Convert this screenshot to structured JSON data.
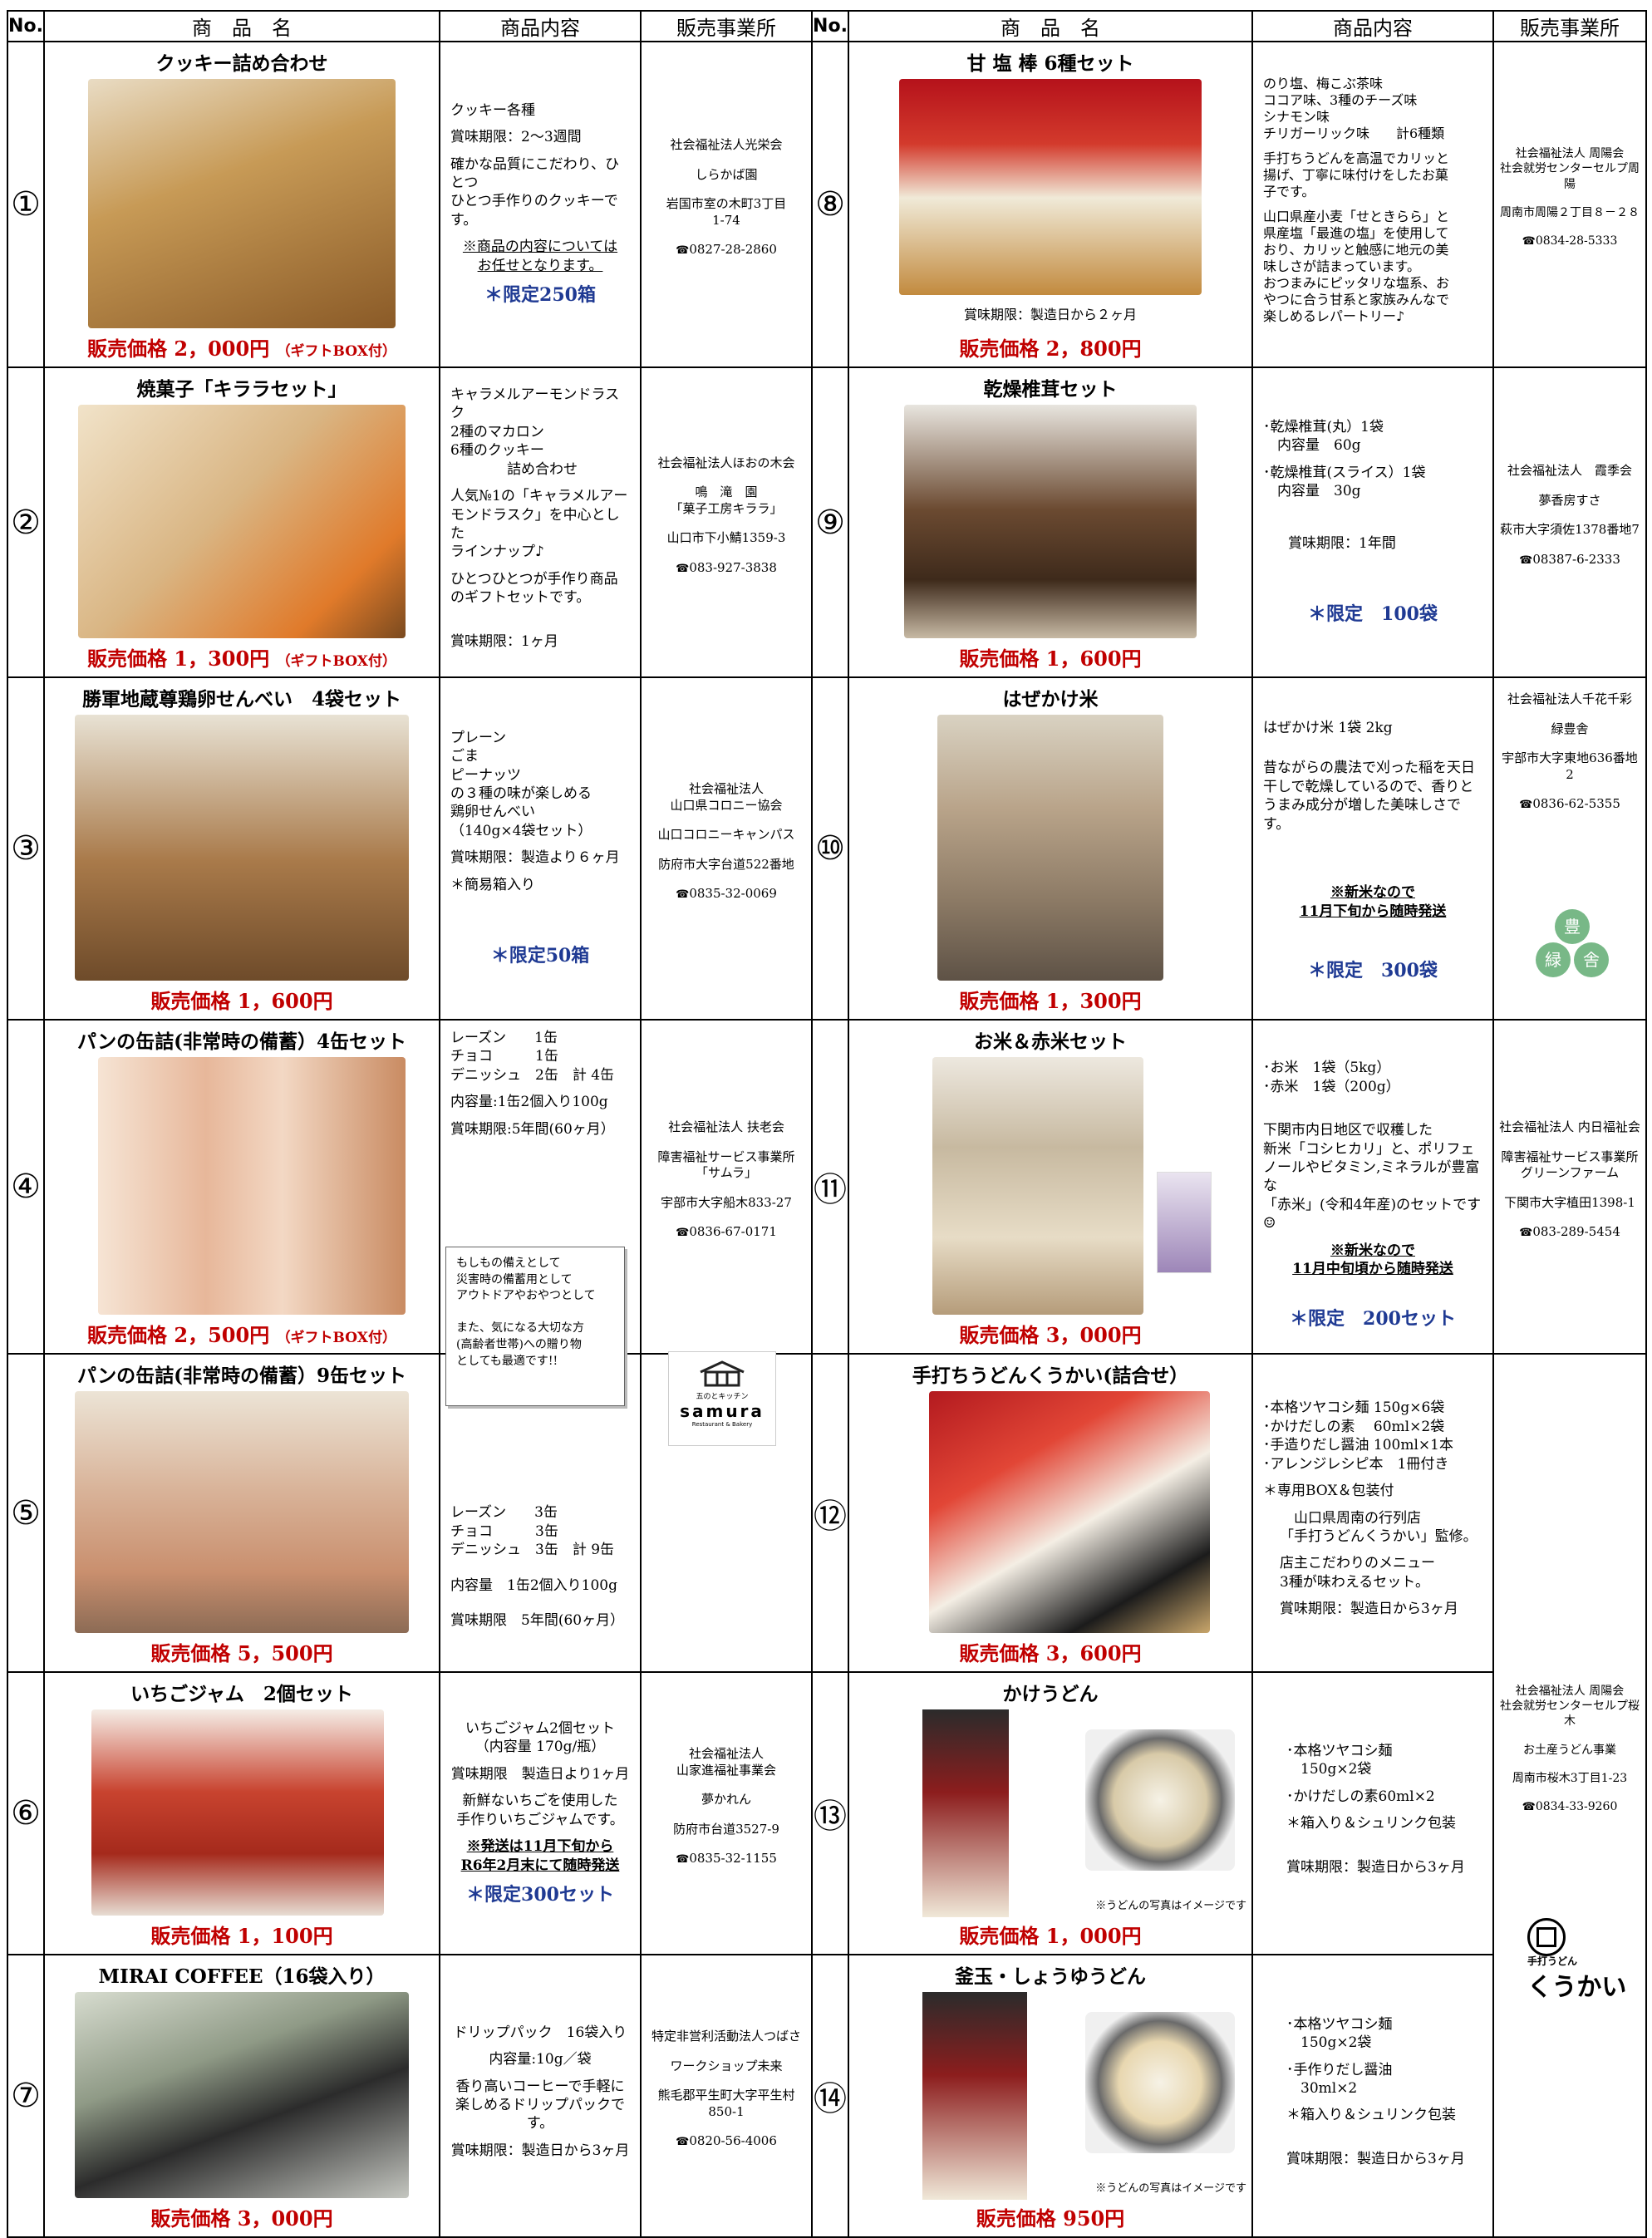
{
  "headers": {
    "no": "No.",
    "name": "商　品　名",
    "content": "商品内容",
    "seller": "販売事業所"
  },
  "products": [
    {
      "num": "①",
      "name": "クッキー詰め合わせ",
      "price": "販売価格 2，000円",
      "box": "（ギフトBOX付）",
      "content": [
        "クッキー各種",
        "賞味期限：2～3週間",
        "確かな品質にこだわり、ひとつ\nひとつ手作りのクッキーです。"
      ],
      "note_ul": "※商品の内容については\nお任せとなります。",
      "limit": "＊限定250箱",
      "seller": [
        "社会福祉法人光栄会",
        "しらかば園",
        "岩国市室の木町3丁目\n1-74"
      ],
      "tel": "0827-28-2860"
    },
    {
      "num": "②",
      "name": "焼菓子「キララセット」",
      "price": "販売価格 1，300円",
      "box": "（ギフトBOX付）",
      "content": [
        "キャラメルアーモンドラスク\n2種のマカロン\n6種のクッキー\n　　　　詰め合わせ",
        "人気№1の「キャラメルアー\nモンドラスク」を中心とした\nラインナップ♪",
        "ひとつひとつが手作り商品\nのギフトセットです。",
        "賞味期限：1ヶ月"
      ],
      "seller": [
        "社会福祉法人ほおの木会",
        "鳴　滝　園\n「菓子工房キララ」",
        "山口市下小鯖1359-3"
      ],
      "tel": "083-927-3838"
    },
    {
      "num": "③",
      "name": "勝軍地蔵尊鶏卵せんべい　4袋セット",
      "price": "販売価格 1，600円",
      "content": [
        "プレーン\nごま\nピーナッツ\nの３種の味が楽しめる\n鶏卵せんべい\n（140g×4袋セット）",
        "賞味期限：製造より６ヶ月",
        "＊簡易箱入り"
      ],
      "limit": "＊限定50箱",
      "seller": [
        "社会福祉法人\n山口県コロニー協会",
        "山口コロニーキャンパス",
        "防府市大字台道522番地"
      ],
      "tel": "0835-32-0069"
    },
    {
      "num": "④",
      "name": "パンの缶詰(非常時の備蓄）4缶セット",
      "price": "販売価格 2，500円",
      "box": "（ギフトBOX付）",
      "content": [
        "レーズン　　1缶\nチョコ　　　1缶\nデニッシュ　2缶　計 4缶",
        "内容量:1缶2個入り100g",
        "賞味期限:5年間(60ヶ月）"
      ],
      "seller": [
        "社会福祉法人 扶老会",
        "障害福祉サービス事業所\n「サムラ」",
        "宇部市大字船木833-27"
      ],
      "tel": "0836-67-0171",
      "memo": "もしもの備えとして\n災害時の備蓄用として\nアウトドアやおやつとして\n\nまた、気になる大切な方\n(高齢者世帯)への贈り物\nとしても最適です!!"
    },
    {
      "num": "⑤",
      "name": "パンの缶詰(非常時の備蓄）9缶セット",
      "price": "販売価格 5，500円",
      "content": [
        "レーズン　　3缶\nチョコ　　　3缶\nデニッシュ　3缶　計 9缶",
        "内容量　1缶2個入り100g",
        "賞味期限　5年間(60ヶ月）"
      ],
      "logo_small": "五のとキッチン",
      "logo_big": "samura",
      "logo_sub": "Restaurant & Bakery"
    },
    {
      "num": "⑥",
      "name": "いちごジャム　2個セット",
      "price": "販売価格 1，100円",
      "content": [
        "いちごジャム2個セット\n（内容量 170g/瓶）",
        "賞味期限　製造日より1ヶ月",
        "新鮮ないちごを使用した\n手作りいちごジャムです。"
      ],
      "note_ul": "※発送は11月下旬から\nR6年2月末にて随時発送",
      "limit": "＊限定300セット",
      "seller": [
        "社会福祉法人\n山家進福祉事業会",
        "夢かれん",
        "防府市台道3527-9"
      ],
      "tel": "0835-32-1155"
    },
    {
      "num": "⑦",
      "name": "MIRAI COFFEE（16袋入り）",
      "price": "販売価格 3，000円",
      "content": [
        "ドリップパック　16袋入り",
        "内容量:10g／袋",
        "香り高いコーヒーで手軽に\n楽しめるドリップパックです。",
        "賞味期限：製造日から3ヶ月"
      ],
      "seller": [
        "特定非営利活動法人つばさ",
        "ワークショップ未来",
        "熊毛郡平生町大字平生村\n850-1"
      ],
      "tel": "0820-56-4006"
    },
    {
      "num": "⑧",
      "name": "甘 塩 棒 6種セット",
      "price": "販売価格 2，800円",
      "content": [
        "のり塩、梅こぶ茶味\nココア味、3種のチーズ味\nシナモン味\nチリガーリック味　　計6種類",
        "手打ちうどんを高温でカリッと\n揚げ、丁寧に味付けをしたお菓\n子です。",
        "山口県産小麦「せときらら」と\n県産塩「最進の塩」を使用して\nおり、カリッと触感に地元の美\n味しさが詰まっています。\nおつまみにピッタリな塩系、お\nやつに合う甘系と家族みんなで\n楽しめるレパートリー♪"
      ],
      "img_caption": "賞味期限：製造日から２ヶ月",
      "seller": [
        "社会福祉法人 周陽会\n社会就労センターセルプ周陽",
        "周南市周陽２丁目８－２８"
      ],
      "tel": "0834-28-5333"
    },
    {
      "num": "⑨",
      "name": "乾燥椎茸セット",
      "price": "販売価格 1，600円",
      "content": [
        "･乾燥椎茸(丸）1袋\n　内容量　60g",
        "･乾燥椎茸(スライス）1袋\n　内容量　30g",
        "賞味期限：1年間"
      ],
      "limit": "＊限定　100袋",
      "seller": [
        "社会福祉法人　霞季会",
        "夢香房すさ",
        "萩市大字須佐1378番地7"
      ],
      "tel": "08387-6-2333"
    },
    {
      "num": "⑩",
      "name": "はぜかけ米",
      "price": "販売価格 1，300円",
      "content": [
        "はぜかけ米 1袋 2kg",
        "昔ながらの農法で刈った稲を天日\n干しで乾燥しているので、香りと\nうまみ成分が増した美味しさです。"
      ],
      "note_ul": "※新米なので\n11月下旬から随時発送",
      "limit": "＊限定　300袋",
      "seller": [
        "社会福祉法人千花千彩",
        "緑豊舎",
        "宇部市大字東地636番地2"
      ],
      "tel": "0836-62-5355",
      "circle_logo": [
        "豊",
        "緑",
        "舎"
      ]
    },
    {
      "num": "⑪",
      "name": "お米＆赤米セット",
      "price": "販売価格 3，000円",
      "content": [
        "･お米　1袋（5kg）\n･赤米　1袋（200g）",
        "下関市内日地区で収穫した\n新米「コシヒカリ」と、ポリフェ\nノールやビタミン,ミネラルが豊富な\n「赤米」(令和4年産)のセットです☺"
      ],
      "note_ul": "※新米なので\n11月中旬頃から随時発送",
      "limit": "＊限定　200セット",
      "seller": [
        "社会福祉法人 内日福祉会",
        "障害福祉サービス事業所\nグリーンファーム",
        "下関市大字植田1398-1"
      ],
      "tel": "083-289-5454"
    },
    {
      "num": "⑫",
      "name": "手打ちうどんくうかい(詰合せ）",
      "price": "販売価格 3，600円",
      "content": [
        "･本格ツヤコシ麺 150g×6袋\n･かけだしの素　 60ml×2袋\n･手造りだし醤油 100ml×1本\n･アレンジレシピ本　1冊付き",
        "＊専用BOX＆包装付",
        "　山口県周南の行列店\n「手打うどんくうかい」監修。",
        "店主こだわりのメニュー\n3種が味わえるセット。",
        "賞味期限：製造日から3ヶ月"
      ]
    },
    {
      "num": "⑬",
      "name": "かけうどん",
      "price": "販売価格 1，000円",
      "content": [
        "･本格ツヤコシ麺\n　150g×2袋",
        "･かけだしの素60ml×2",
        "＊箱入り＆シュリンク包装",
        "賞味期限：製造日から3ヶ月"
      ],
      "img_note": "※うどんの写真はイメージです"
    },
    {
      "num": "⑭",
      "name": "釜玉・しょうゆうどん",
      "price": "販売価格 950円",
      "content": [
        "･本格ツヤコシ麺\n　150g×2袋",
        "･手作りだし醤油\n　30ml×2",
        "＊箱入り＆シュリンク包装",
        "賞味期限：製造日から3ヶ月"
      ],
      "img_note": "※うどんの写真はイメージです"
    }
  ],
  "kuukai_seller": [
    "社会福祉法人 周陽会\n社会就労センターセルプ桜木",
    "お土産うどん事業",
    "周南市桜木3丁目1-23"
  ],
  "kuukai_tel": "0834-33-9260",
  "kuukai_logo": "くうかい",
  "kuukai_logo_small": "手打うどん",
  "colors": {
    "price": "#c00000",
    "limit": "#1f3a93"
  }
}
